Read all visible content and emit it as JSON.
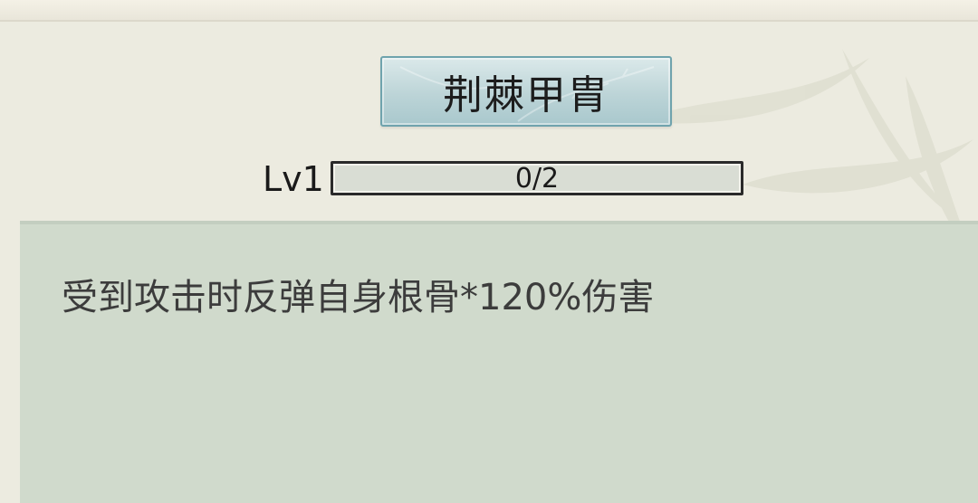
{
  "skill": {
    "name": "荆棘甲胄",
    "level_label": "Lv1",
    "progress_text": "0/2",
    "progress_fraction": 0.0,
    "description": "受到攻击时反弹自身根骨*120%伤害"
  },
  "colors": {
    "background": "#ecebe0",
    "title_button": "#bcd4d7",
    "panel": "#d0dacc"
  },
  "icons": {
    "background_decoration": "bamboo-leaves"
  }
}
